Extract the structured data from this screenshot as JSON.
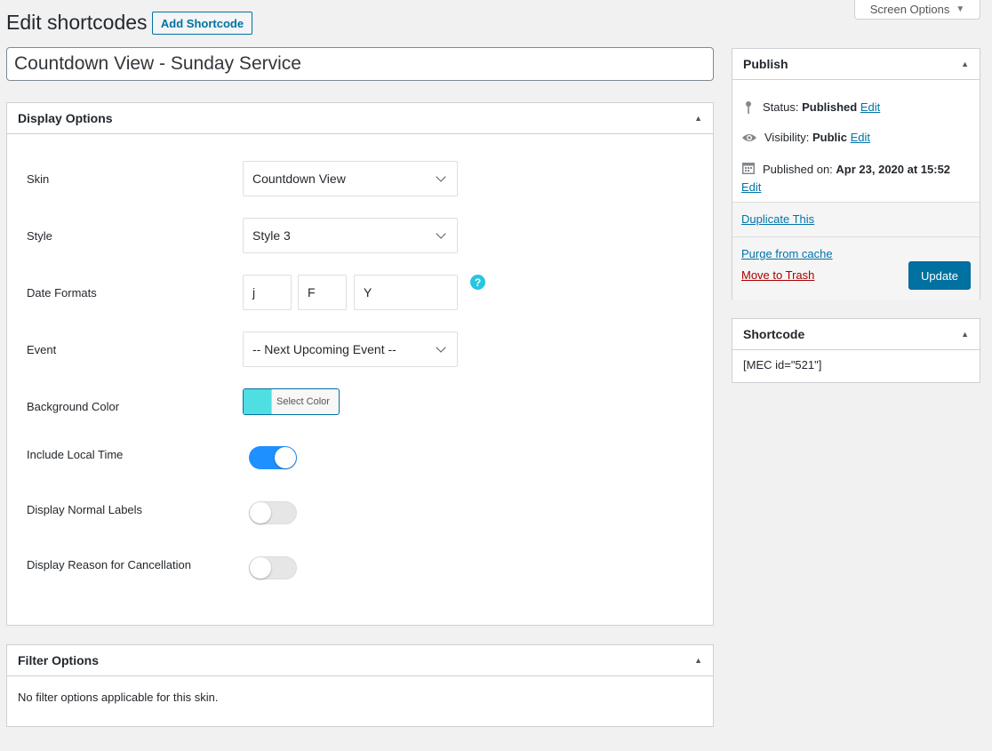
{
  "header": {
    "title": "Edit shortcodes",
    "add_button": "Add Shortcode",
    "screen_options": "Screen Options"
  },
  "post_title": "Countdown View - Sunday Service",
  "display_options": {
    "heading": "Display Options",
    "skin": {
      "label": "Skin",
      "value": "Countdown View"
    },
    "style": {
      "label": "Style",
      "value": "Style 3"
    },
    "date_formats": {
      "label": "Date Formats",
      "values": [
        "j",
        "F",
        "Y"
      ],
      "help": "?"
    },
    "event": {
      "label": "Event",
      "value": "-- Next Upcoming Event --"
    },
    "background_color": {
      "label": "Background Color",
      "button": "Select Color",
      "color": "#4fdfe2"
    },
    "include_local_time": {
      "label": "Include Local Time",
      "on": true
    },
    "display_normal_labels": {
      "label": "Display Normal Labels",
      "on": false
    },
    "display_reason": {
      "label": "Display Reason for Cancellation",
      "on": false
    }
  },
  "filter_options": {
    "heading": "Filter Options",
    "message": "No filter options applicable for this skin."
  },
  "publish": {
    "heading": "Publish",
    "status_label": "Status:",
    "status_value": "Published",
    "visibility_label": "Visibility:",
    "visibility_value": "Public",
    "published_label": "Published on:",
    "published_value": "Apr 23, 2020 at 15:52",
    "edit": "Edit",
    "duplicate": "Duplicate This",
    "purge": "Purge from cache",
    "trash": "Move to Trash",
    "update": "Update"
  },
  "shortcode": {
    "heading": "Shortcode",
    "value": "[MEC id=\"521\"]"
  },
  "colors": {
    "accent": "#0071a1",
    "toggle_on": "#1e90ff",
    "help": "#27c6e0",
    "trash": "#aa0000"
  }
}
